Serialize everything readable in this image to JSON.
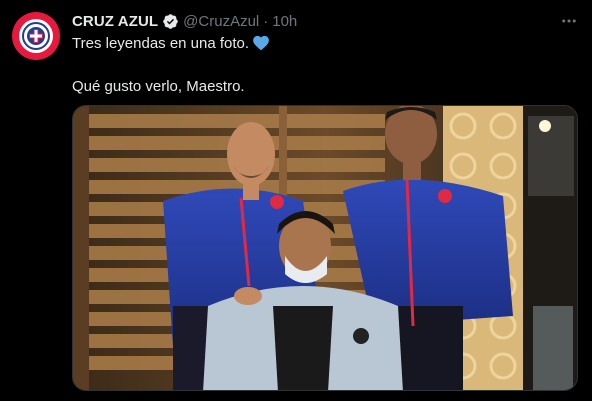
{
  "tweet": {
    "display_name": "CRUZ AZUL",
    "handle": "@CruzAzul",
    "separator": "·",
    "time": "10h",
    "line1": "Tres leyendas en una foto.",
    "line2": "Qué gusto verlo, Maestro."
  },
  "icons": {
    "avatar": "cruz-azul-crest",
    "verified": "verified-badge-icon",
    "more": "more-options-icon",
    "heart": "blue-heart-emoji"
  },
  "colors": {
    "background": "#000000",
    "text": "#e7e9ea",
    "secondary": "#71767b",
    "verified": "#e7e9ea",
    "heart": "#5aa9e6",
    "avatar_ring": "#e61a3f"
  }
}
